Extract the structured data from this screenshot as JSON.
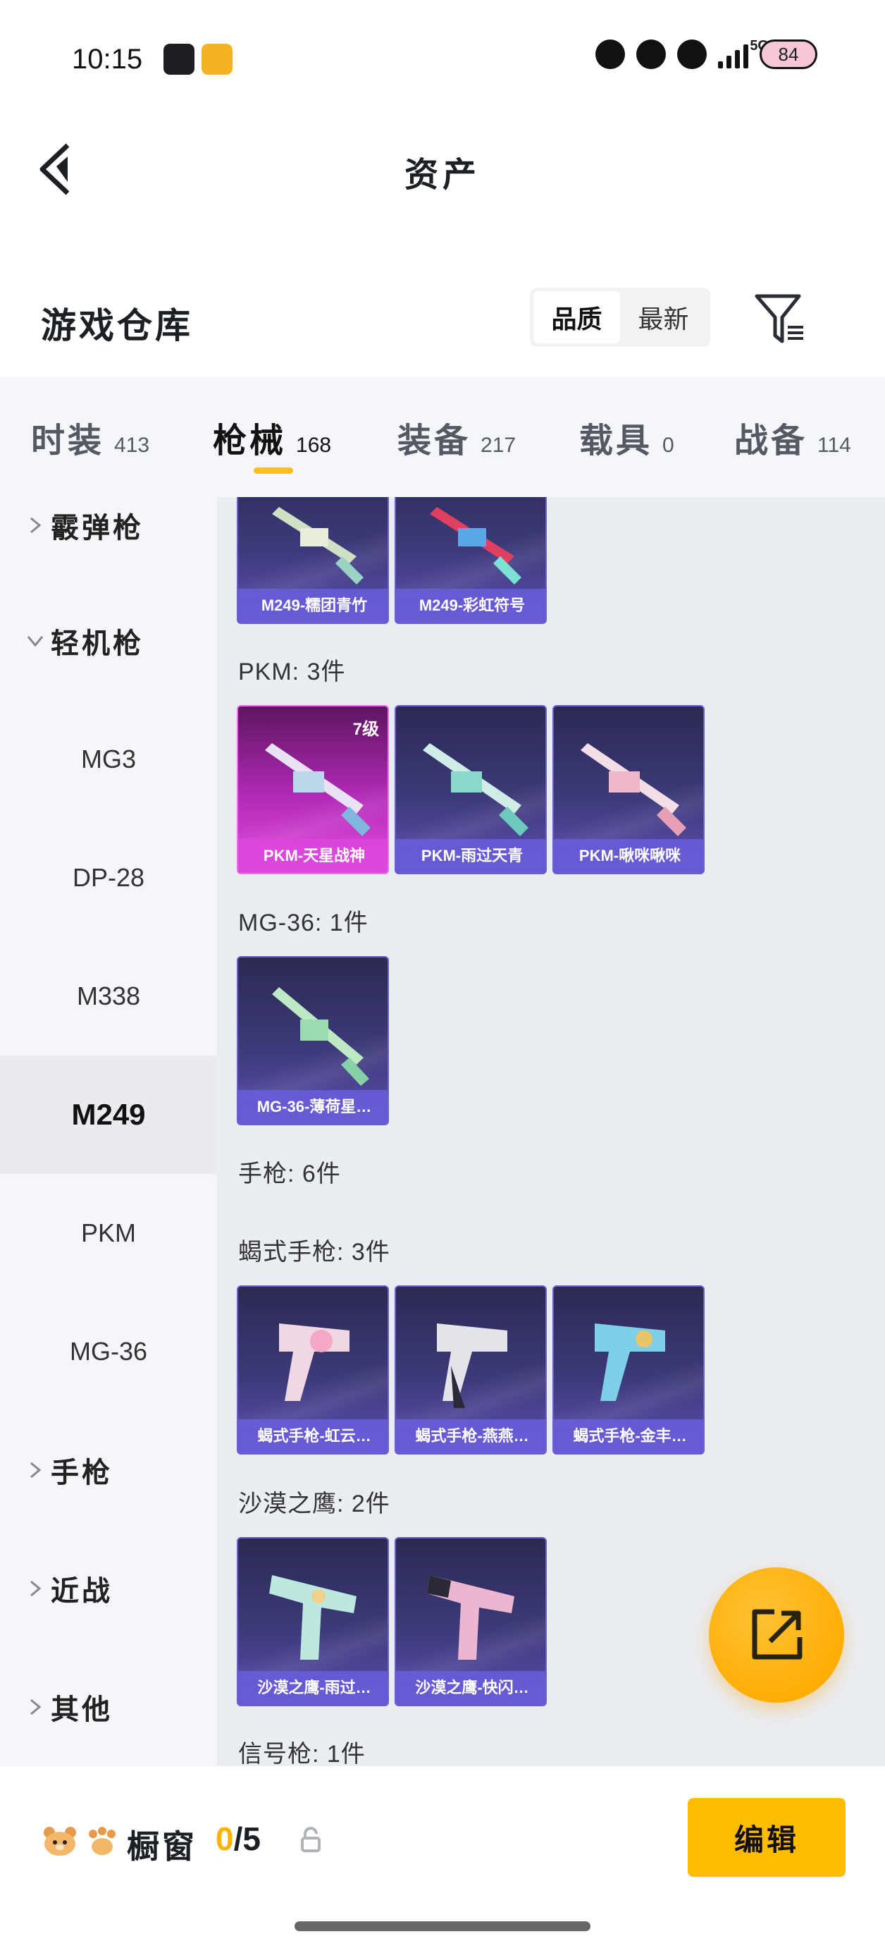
{
  "status_bar": {
    "time": "10:15",
    "network": "5G",
    "battery": "84"
  },
  "header": {
    "title": "资产"
  },
  "warehouse": {
    "title": "游戏仓库",
    "sort_options": [
      {
        "label": "品质",
        "active": true
      },
      {
        "label": "最新",
        "active": false
      }
    ]
  },
  "tabs": [
    {
      "label": "时装",
      "count": "413"
    },
    {
      "label": "枪械",
      "count": "168"
    },
    {
      "label": "装备",
      "count": "217"
    },
    {
      "label": "载具",
      "count": "0"
    },
    {
      "label": "战备",
      "count": "114"
    }
  ],
  "sidebar": {
    "items": [
      {
        "label": "霰弹枪",
        "type": "group"
      },
      {
        "label": "轻机枪",
        "type": "group"
      },
      {
        "label": "MG3",
        "type": "sub"
      },
      {
        "label": "DP-28",
        "type": "sub"
      },
      {
        "label": "M338",
        "type": "sub"
      },
      {
        "label": "M249",
        "type": "sub"
      },
      {
        "label": "PKM",
        "type": "sub"
      },
      {
        "label": "MG-36",
        "type": "sub"
      },
      {
        "label": "手枪",
        "type": "group"
      },
      {
        "label": "近战",
        "type": "group"
      },
      {
        "label": "其他",
        "type": "group"
      }
    ]
  },
  "content": {
    "top_cards": [
      {
        "name": "M249-糯团青竹"
      },
      {
        "name": "M249-彩虹符号"
      }
    ],
    "pkm": {
      "label": "PKM: 3件",
      "cards": [
        {
          "name": "PKM-天星战神",
          "level": "7级"
        },
        {
          "name": "PKM-雨过天青"
        },
        {
          "name": "PKM-啾咪啾咪"
        }
      ]
    },
    "mg36": {
      "label": "MG-36: 1件",
      "cards": [
        {
          "name": "MG-36-薄荷星…"
        }
      ]
    },
    "pistol_label": "手枪: 6件",
    "scorpion": {
      "label": "蝎式手枪: 3件",
      "cards": [
        {
          "name": "蝎式手枪-虹云…"
        },
        {
          "name": "蝎式手枪-燕燕…"
        },
        {
          "name": "蝎式手枪-金丰…"
        }
      ]
    },
    "deagle": {
      "label": "沙漠之鹰: 2件",
      "cards": [
        {
          "name": "沙漠之鹰-雨过…"
        },
        {
          "name": "沙漠之鹰-快闪…"
        }
      ]
    },
    "flare_label": "信号枪: 1件"
  },
  "bottom_bar": {
    "label": "橱窗",
    "count_current": "0",
    "count_total": "/5",
    "edit_label": "编辑"
  },
  "colors": {
    "accent": "#ffbc00",
    "purple_card": "#5a4fb0",
    "gold_card": "#e34ee0"
  }
}
